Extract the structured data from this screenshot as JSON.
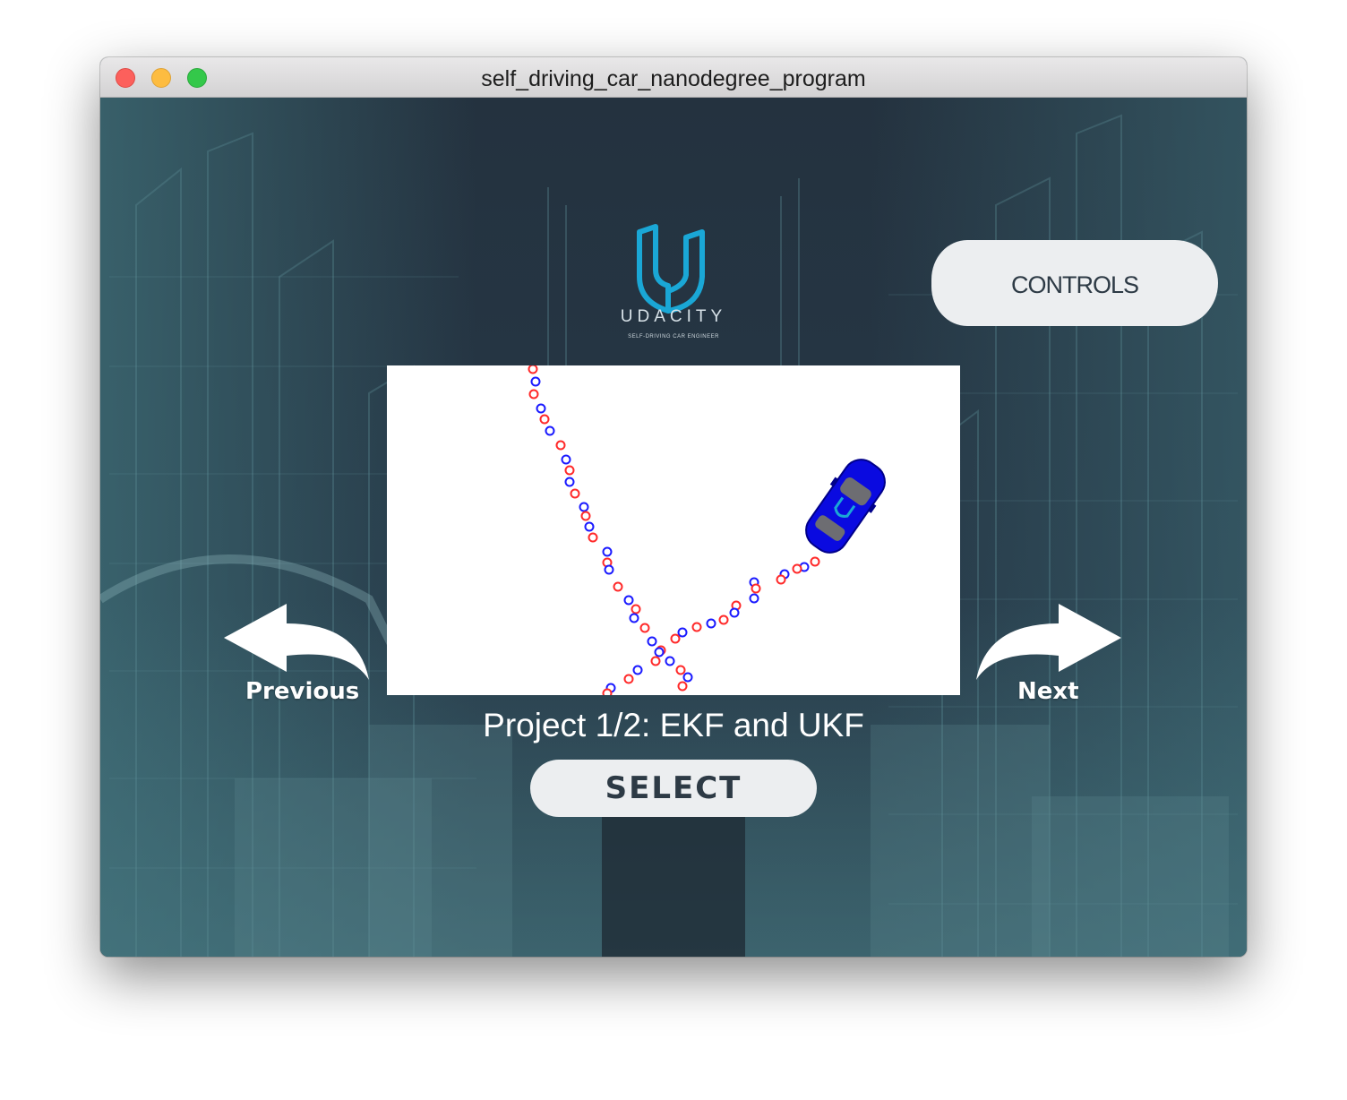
{
  "window": {
    "title": "self_driving_car_nanodegree_program"
  },
  "logo": {
    "brand": "UDACITY",
    "tagline": "SELF-DRIVING CAR ENGINEER",
    "color": "#1aa7d6"
  },
  "controls": {
    "label": "CONTROLS"
  },
  "navigation": {
    "previous_label": "Previous",
    "next_label": "Next"
  },
  "project": {
    "title": "Project 1/2: EKF and UKF"
  },
  "select": {
    "label": "SELECT"
  },
  "preview": {
    "marker_colors": {
      "lidar": "#ff2a2a",
      "radar": "#1a1aff",
      "car": "#0a0ae0"
    }
  },
  "colors": {
    "background": "#243340",
    "button": "#eceef0",
    "button_text": "#2d3a45"
  }
}
